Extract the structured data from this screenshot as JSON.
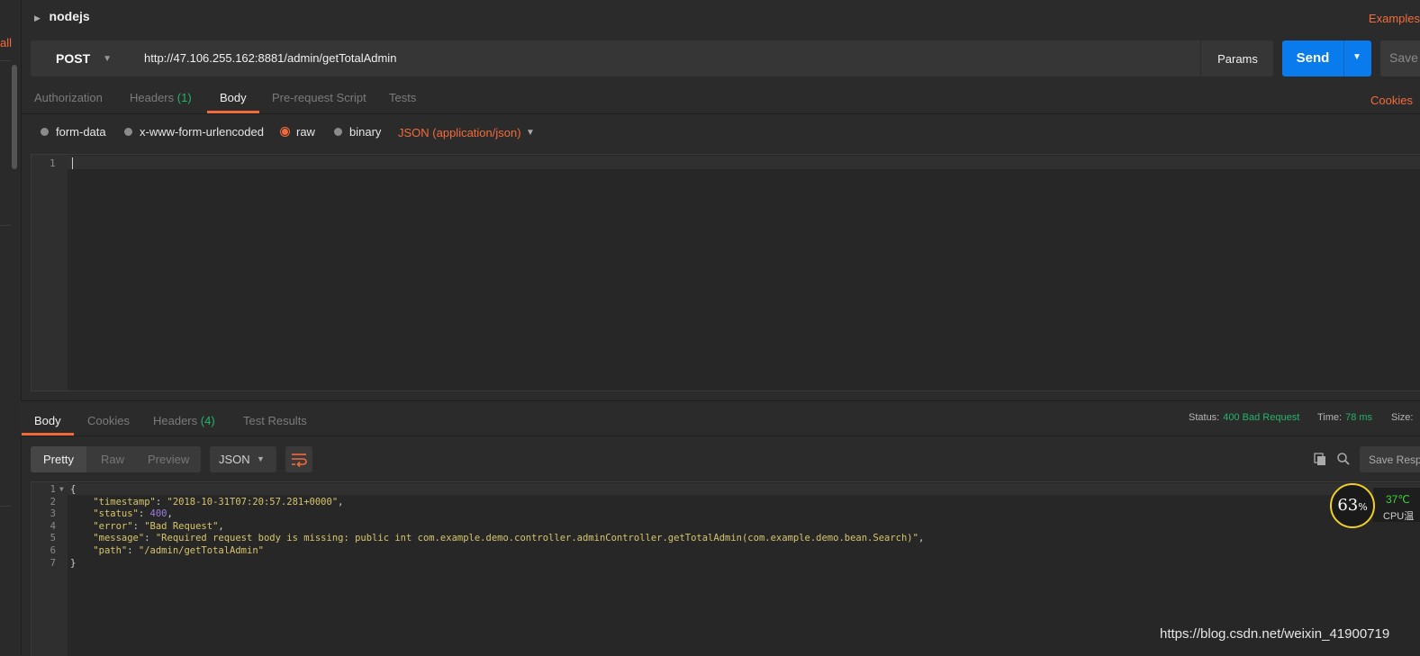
{
  "sidebar": {
    "partial_label": "all"
  },
  "collection": {
    "name": "nodejs",
    "examples_label": "Examples"
  },
  "request": {
    "method": "POST",
    "url": "http://47.106.255.162:8881/admin/getTotalAdmin",
    "params_label": "Params",
    "send_label": "Send",
    "save_label": "Save"
  },
  "request_tabs": [
    {
      "label": "Authorization"
    },
    {
      "label": "Headers",
      "count": "(1)"
    },
    {
      "label": "Body"
    },
    {
      "label": "Pre-request Script"
    },
    {
      "label": "Tests"
    }
  ],
  "cookies_label": "Cookies",
  "body_modes": [
    {
      "label": "form-data"
    },
    {
      "label": "x-www-form-urlencoded"
    },
    {
      "label": "raw"
    },
    {
      "label": "binary"
    }
  ],
  "content_type": "JSON (application/json)",
  "request_editor": {
    "line": "1"
  },
  "response_tabs": [
    {
      "label": "Body"
    },
    {
      "label": "Cookies"
    },
    {
      "label": "Headers",
      "count": "(4)"
    },
    {
      "label": "Test Results"
    }
  ],
  "response_meta": {
    "status_label": "Status:",
    "status_value": "400 Bad Request",
    "time_label": "Time:",
    "time_value": "78 ms",
    "size_label": "Size:"
  },
  "response_toolbar": {
    "pretty": "Pretty",
    "raw": "Raw",
    "preview": "Preview",
    "format": "JSON",
    "save_response": "Save Response"
  },
  "response_lines": [
    {
      "n": "1",
      "text": "{"
    },
    {
      "n": "2",
      "key": "\"timestamp\"",
      "value": "\"2018-10-31T07:20:57.281+0000\"",
      "type": "string"
    },
    {
      "n": "3",
      "key": "\"status\"",
      "value": "400",
      "type": "number"
    },
    {
      "n": "4",
      "key": "\"error\"",
      "value": "\"Bad Request\"",
      "type": "string"
    },
    {
      "n": "5",
      "key": "\"message\"",
      "value": "\"Required request body is missing: public int com.example.demo.controller.adminController.getTotalAdmin(com.example.demo.bean.Search)\"",
      "type": "string"
    },
    {
      "n": "6",
      "key": "\"path\"",
      "value": "\"/admin/getTotalAdmin\"",
      "type": "string",
      "last": true
    },
    {
      "n": "7",
      "text": "}"
    }
  ],
  "cpu_widget": {
    "percent": "63",
    "unit": "%",
    "temp": "37℃",
    "label": "CPU温"
  },
  "watermark": "https://blog.csdn.net/weixin_41900719",
  "colors": {
    "accent": "#f26b3a",
    "send": "#097bed",
    "ok_green": "#23b46a"
  }
}
